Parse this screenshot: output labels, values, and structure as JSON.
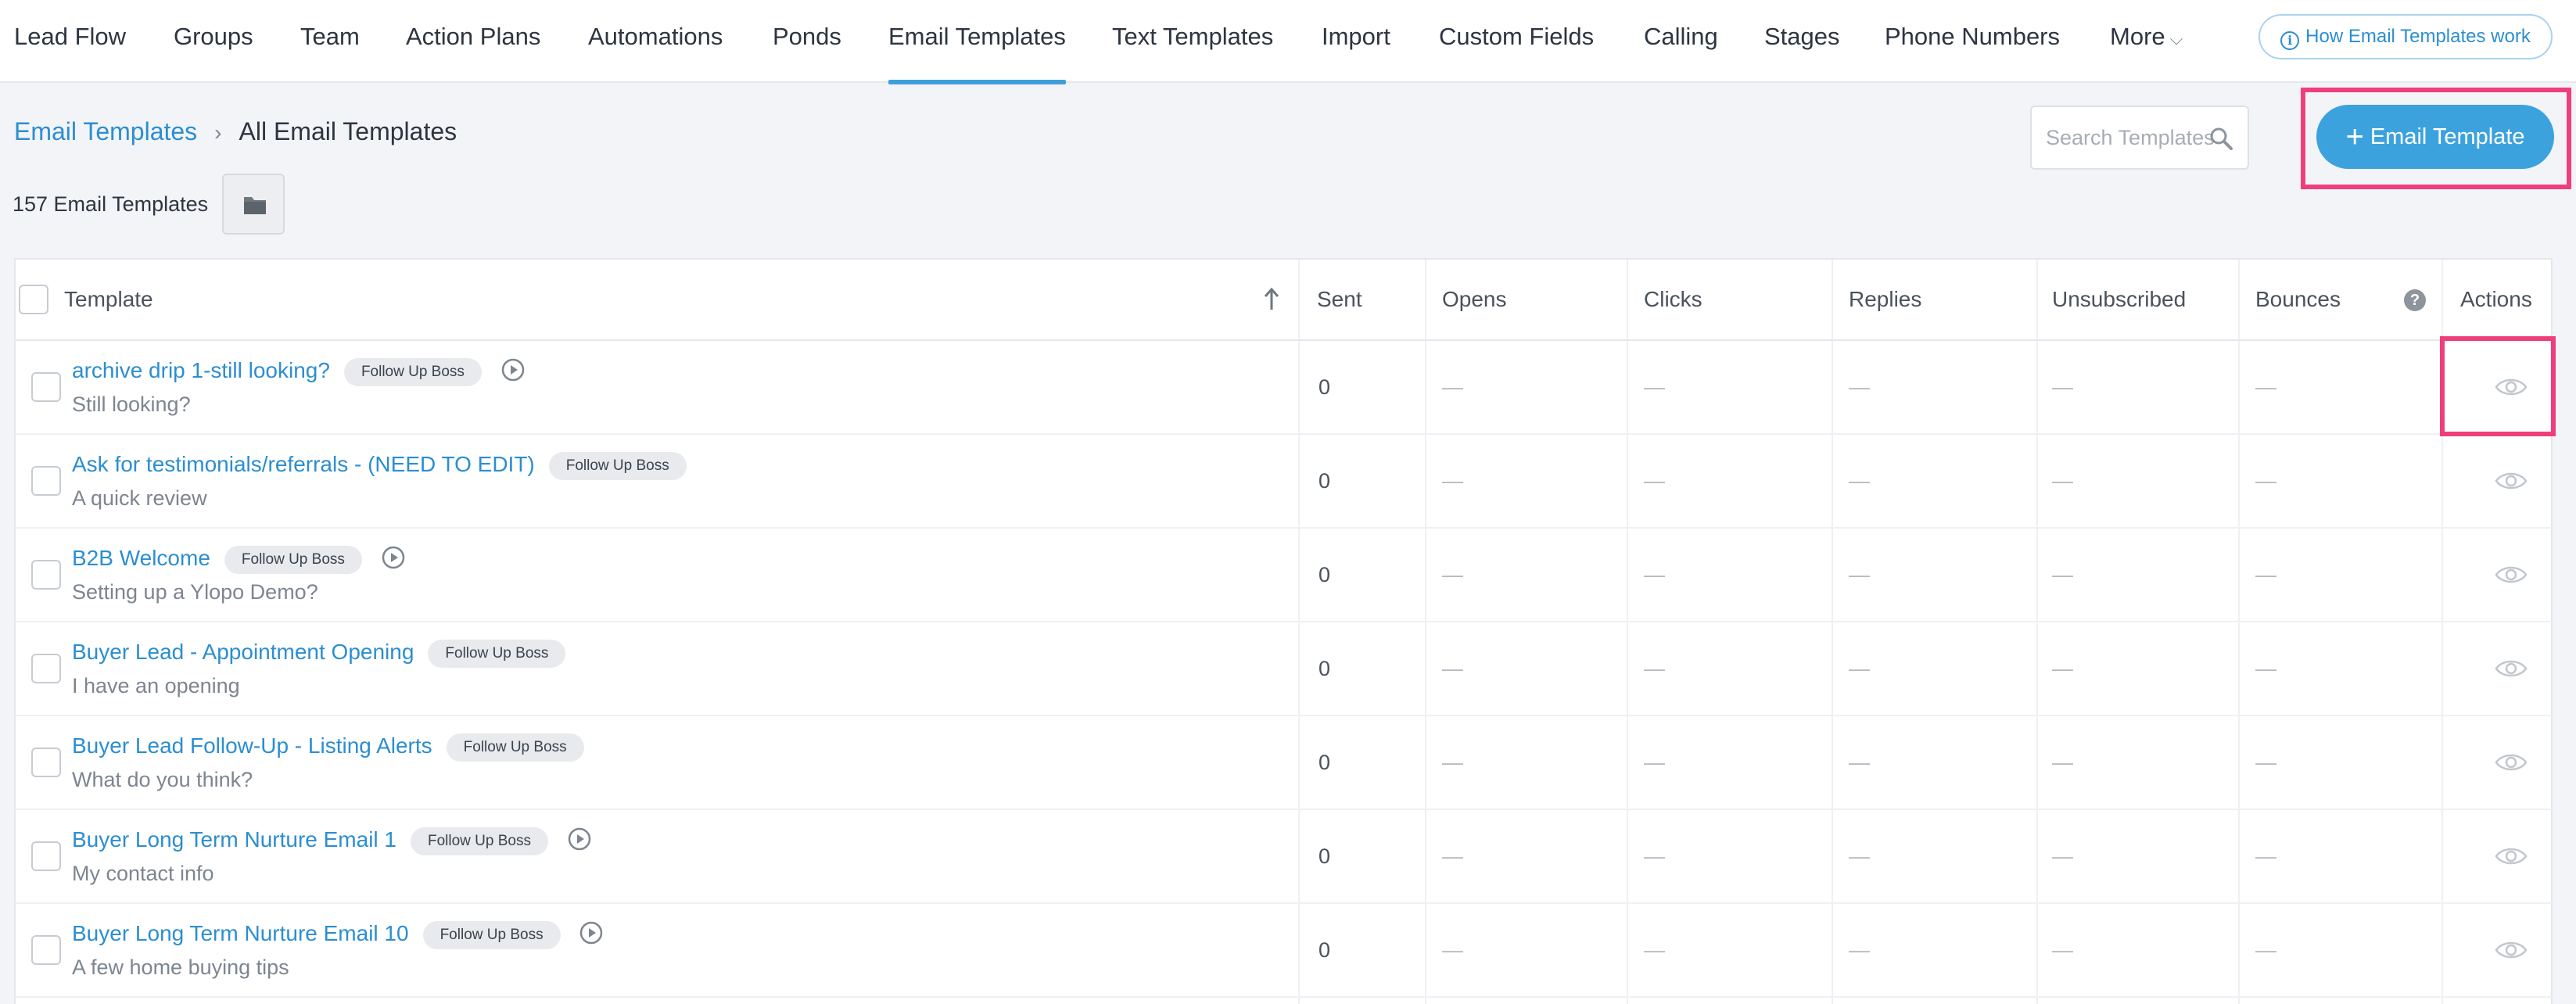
{
  "nav": {
    "items": [
      {
        "label": "Lead Flow",
        "active": false
      },
      {
        "label": "Groups",
        "active": false
      },
      {
        "label": "Team",
        "active": false
      },
      {
        "label": "Action Plans",
        "active": false
      },
      {
        "label": "Automations",
        "active": false
      },
      {
        "label": "Ponds",
        "active": false
      },
      {
        "label": "Email Templates",
        "active": true
      },
      {
        "label": "Text Templates",
        "active": false
      },
      {
        "label": "Import",
        "active": false
      },
      {
        "label": "Custom Fields",
        "active": false
      },
      {
        "label": "Calling",
        "active": false
      },
      {
        "label": "Stages",
        "active": false
      },
      {
        "label": "Phone Numbers",
        "active": false
      }
    ],
    "more_label": "More",
    "help_label": "How Email Templates work"
  },
  "breadcrumb": {
    "root": "Email Templates",
    "current": "All Email Templates"
  },
  "search": {
    "placeholder": "Search Templates",
    "value": ""
  },
  "add_button_label": "Email Template",
  "count_label": "157 Email Templates",
  "table": {
    "columns": {
      "template": "Template",
      "sent": "Sent",
      "opens": "Opens",
      "clicks": "Clicks",
      "replies": "Replies",
      "unsubscribed": "Unsubscribed",
      "bounces": "Bounces",
      "actions": "Actions"
    },
    "rows": [
      {
        "name": "archive drip 1-still looking?",
        "tag": "Follow Up Boss",
        "has_play": true,
        "subject": "Still looking?",
        "sent": "0",
        "opens": "—",
        "clicks": "—",
        "replies": "—",
        "unsubscribed": "—",
        "bounces": "—"
      },
      {
        "name": "Ask for testimonials/referrals - (NEED TO EDIT)",
        "tag": "Follow Up Boss",
        "has_play": false,
        "subject": "A quick review",
        "sent": "0",
        "opens": "—",
        "clicks": "—",
        "replies": "—",
        "unsubscribed": "—",
        "bounces": "—"
      },
      {
        "name": "B2B Welcome",
        "tag": "Follow Up Boss",
        "has_play": true,
        "subject": "Setting up a Ylopo Demo?",
        "sent": "0",
        "opens": "—",
        "clicks": "—",
        "replies": "—",
        "unsubscribed": "—",
        "bounces": "—"
      },
      {
        "name": "Buyer Lead - Appointment Opening",
        "tag": "Follow Up Boss",
        "has_play": false,
        "subject": "I have an opening",
        "sent": "0",
        "opens": "—",
        "clicks": "—",
        "replies": "—",
        "unsubscribed": "—",
        "bounces": "—"
      },
      {
        "name": "Buyer Lead Follow-Up - Listing Alerts",
        "tag": "Follow Up Boss",
        "has_play": false,
        "subject": "What do you think?",
        "sent": "0",
        "opens": "—",
        "clicks": "—",
        "replies": "—",
        "unsubscribed": "—",
        "bounces": "—"
      },
      {
        "name": "Buyer Long Term Nurture Email 1",
        "tag": "Follow Up Boss",
        "has_play": true,
        "subject": "My contact info",
        "sent": "0",
        "opens": "—",
        "clicks": "—",
        "replies": "—",
        "unsubscribed": "—",
        "bounces": "—"
      },
      {
        "name": "Buyer Long Term Nurture Email 10",
        "tag": "Follow Up Boss",
        "has_play": true,
        "subject": "A few home buying tips",
        "sent": "0",
        "opens": "—",
        "clicks": "—",
        "replies": "—",
        "unsubscribed": "—",
        "bounces": "—"
      }
    ]
  },
  "icons": {
    "search": "search-icon",
    "folder": "folder-icon",
    "info": "info-icon",
    "sort": "sort-up-arrow-icon",
    "help": "help-icon",
    "play": "play-icon",
    "view": "eye-icon"
  },
  "colors": {
    "accent": "#3ca2de",
    "link": "#2b8ed1",
    "highlight": "#ee3f7a"
  }
}
